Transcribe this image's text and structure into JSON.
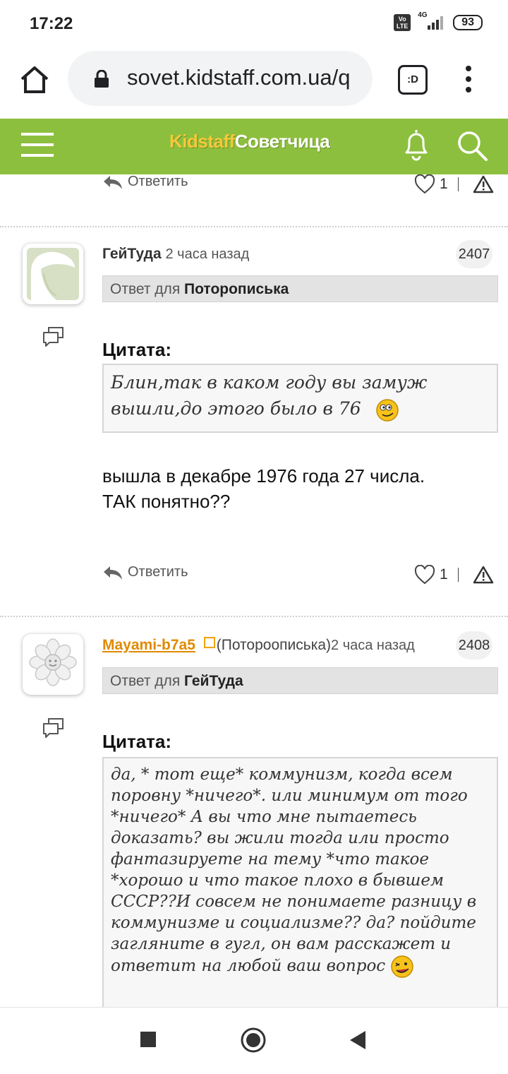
{
  "status": {
    "time": "17:22",
    "network": "4G",
    "volte": "Vo LTE",
    "battery": "93"
  },
  "browser": {
    "url": "sovet.kidstaff.com.ua/q",
    "tabs_label": ":D"
  },
  "site": {
    "logo_part1": "Kidstaff",
    "logo_part2": "Советчица"
  },
  "top_post": {
    "reply_label": "Ответить",
    "likes": "1"
  },
  "posts": [
    {
      "author": "ГейТуда",
      "time": "2 часа назад",
      "number": "2407",
      "reply_prefix": "Ответ для",
      "reply_to": "Поторописька",
      "quote_label": "Цитата:",
      "quote": "Блин,так в каком году вы замуж вышли,до этого было в 76",
      "body_line1": "вышла в декабре 1976 года 27 числа.",
      "body_line2": "ТАК понятно??",
      "reply_label": "Ответить",
      "likes": "1"
    },
    {
      "author": "Mayami-b7a5",
      "author_note": "(Потороописька)",
      "time": "2 часа назад",
      "number": "2408",
      "reply_prefix": "Ответ для",
      "reply_to": "ГейТуда",
      "quote_label": "Цитата:",
      "quote": "да, * тот еще* коммунизм, когда всем поровну *ничего*. или минимум от того *ничего* А вы что мне пытаетесь доказать? вы жили тогда или просто фантазируете на тему *что такое *хорошо и что такое плохо в бывшем СССР??И совсем не понимаете разницу в коммунизме и социализме?? да? пойдите загляните в гугл, он вам расскажет и ответит на любой ваш вопрос"
    }
  ],
  "colors": {
    "header_green": "#8dbf3e",
    "logo_yellow": "#f5c93a",
    "author_link_orange": "#e08a00"
  },
  "icons": [
    "home-icon",
    "lock-icon",
    "tabs-icon",
    "menu-kebab-icon",
    "hamburger-icon",
    "bell-icon",
    "search-icon",
    "reply-arrow-icon",
    "heart-icon",
    "warning-icon",
    "quote-bubbles-icon",
    "smiley-icon",
    "stop-square-icon",
    "home-circle-icon",
    "back-triangle-icon"
  ]
}
